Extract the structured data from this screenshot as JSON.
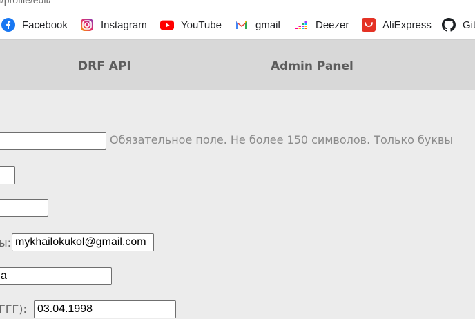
{
  "browser": {
    "url_fragment": "t/profile/edit/",
    "bookmarks": [
      {
        "label": "Facebook",
        "icon": "facebook-icon"
      },
      {
        "label": "Instagram",
        "icon": "instagram-icon"
      },
      {
        "label": "YouTube",
        "icon": "youtube-icon"
      },
      {
        "label": "gmail",
        "icon": "gmail-icon"
      },
      {
        "label": "Deezer",
        "icon": "deezer-icon"
      },
      {
        "label": "AliExpress",
        "icon": "aliexpress-icon"
      },
      {
        "label": "Git",
        "icon": "github-icon"
      }
    ]
  },
  "nav": {
    "drf_api": "DRF API",
    "admin_panel": "Admin Panel"
  },
  "form": {
    "username_value": "",
    "username_help": "Обязательное поле. Не более 150 символов. Только буквы",
    "field2_value": "",
    "field3_value": "",
    "email_label_fragment": "ы:",
    "email_value": "mykhailokukol@gmail.com",
    "field5_value": "а",
    "birthdate_label_fragment": "ГГГ):",
    "birthdate_value": "03.04.1998"
  },
  "colors": {
    "page_bg": "#ececec",
    "nav_bg": "#d8d8d8",
    "nav_text": "#5c5c5c"
  }
}
